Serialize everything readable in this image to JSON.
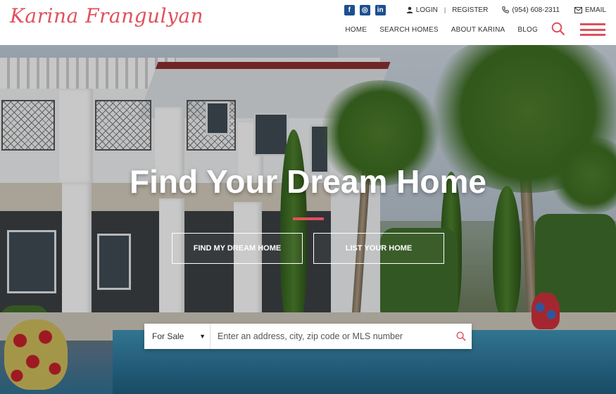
{
  "header": {
    "logo_text": "Karina Frangulyan",
    "social": {
      "facebook": "f",
      "instagram": "◎",
      "linkedin": "in"
    },
    "login_label": "LOGIN",
    "separator": "|",
    "register_label": "REGISTER",
    "phone": "(954) 608-2311",
    "email_label": "EMAIL",
    "nav": [
      "HOME",
      "SEARCH HOMES",
      "ABOUT KARINA",
      "BLOG"
    ]
  },
  "hero": {
    "title": "Find Your Dream Home",
    "cta_primary": "FIND MY DREAM HOME",
    "cta_secondary": "LIST YOUR HOME"
  },
  "search": {
    "selected_type": "For Sale",
    "placeholder": "Enter an address, city, zip code or MLS number"
  },
  "colors": {
    "accent": "#e0505c",
    "social_blue": "#1c4f8f"
  },
  "icons": [
    "facebook-icon",
    "instagram-icon",
    "linkedin-icon",
    "user-icon",
    "phone-icon",
    "mail-icon",
    "search-icon",
    "hamburger-menu-icon",
    "chevron-down-icon"
  ]
}
